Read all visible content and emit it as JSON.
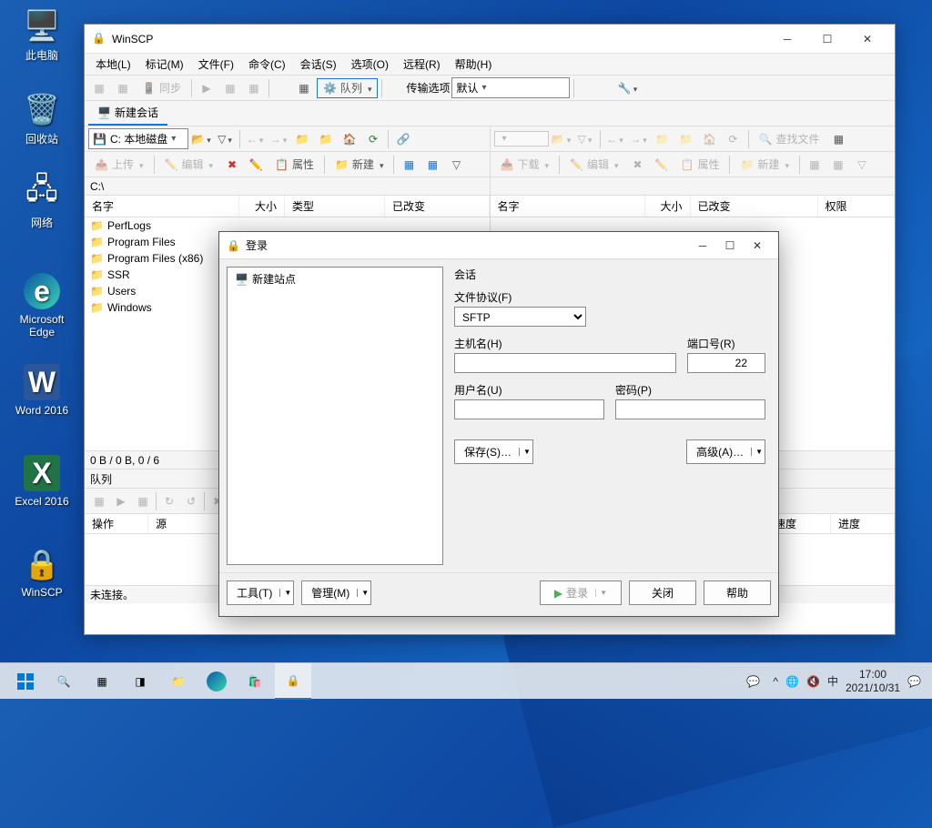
{
  "desktop": {
    "icons": [
      {
        "label": "此电脑",
        "glyph": "🖥️"
      },
      {
        "label": "回收站",
        "glyph": "♻️"
      },
      {
        "label": "网络",
        "glyph": "🌐"
      },
      {
        "label": "Microsoft Edge",
        "glyph": "e"
      },
      {
        "label": "Word 2016",
        "glyph": "W"
      },
      {
        "label": "Excel 2016",
        "glyph": "X"
      },
      {
        "label": "WinSCP",
        "glyph": "🔒"
      }
    ]
  },
  "winscp": {
    "title": "WinSCP",
    "menus": [
      "本地(L)",
      "标记(M)",
      "文件(F)",
      "命令(C)",
      "会话(S)",
      "选项(O)",
      "远程(R)",
      "帮助(H)"
    ],
    "sync": "同步",
    "queue_btn": "队列",
    "transfer_label": "传输选项",
    "transfer_value": "默认",
    "new_session": "新建会话",
    "drive": "C: 本地磁盘",
    "upload": "上传",
    "edit": "编辑",
    "props": "属性",
    "new": "新建",
    "download": "下载",
    "find": "查找文件",
    "path_local": "C:\\",
    "cols_local": [
      "名字",
      "大小",
      "类型",
      "已改变"
    ],
    "cols_remote": [
      "名字",
      "大小",
      "已改变",
      "权限"
    ],
    "files": [
      "PerfLogs",
      "Program Files",
      "Program Files (x86)",
      "SSR",
      "Users",
      "Windows"
    ],
    "status_local": "0 B / 0 B,   0 / 6",
    "queue_title": "队列",
    "queue_cols": [
      "操作",
      "源",
      "",
      "",
      "速度",
      "进度"
    ],
    "status_bar": "未连接。"
  },
  "login": {
    "title": "登录",
    "new_site": "新建站点",
    "session": "会话",
    "protocol_label": "文件协议(F)",
    "protocol_value": "SFTP",
    "host_label": "主机名(H)",
    "host_value": "",
    "port_label": "端口号(R)",
    "port_value": "22",
    "user_label": "用户名(U)",
    "user_value": "",
    "pass_label": "密码(P)",
    "pass_value": "",
    "save": "保存(S)…",
    "advanced": "高级(A)…",
    "tools": "工具(T)",
    "manage": "管理(M)",
    "login_btn": "登录",
    "close": "关闭",
    "help": "帮助"
  },
  "taskbar": {
    "ime": "中",
    "time": "17:00",
    "date": "2021/10/31"
  }
}
